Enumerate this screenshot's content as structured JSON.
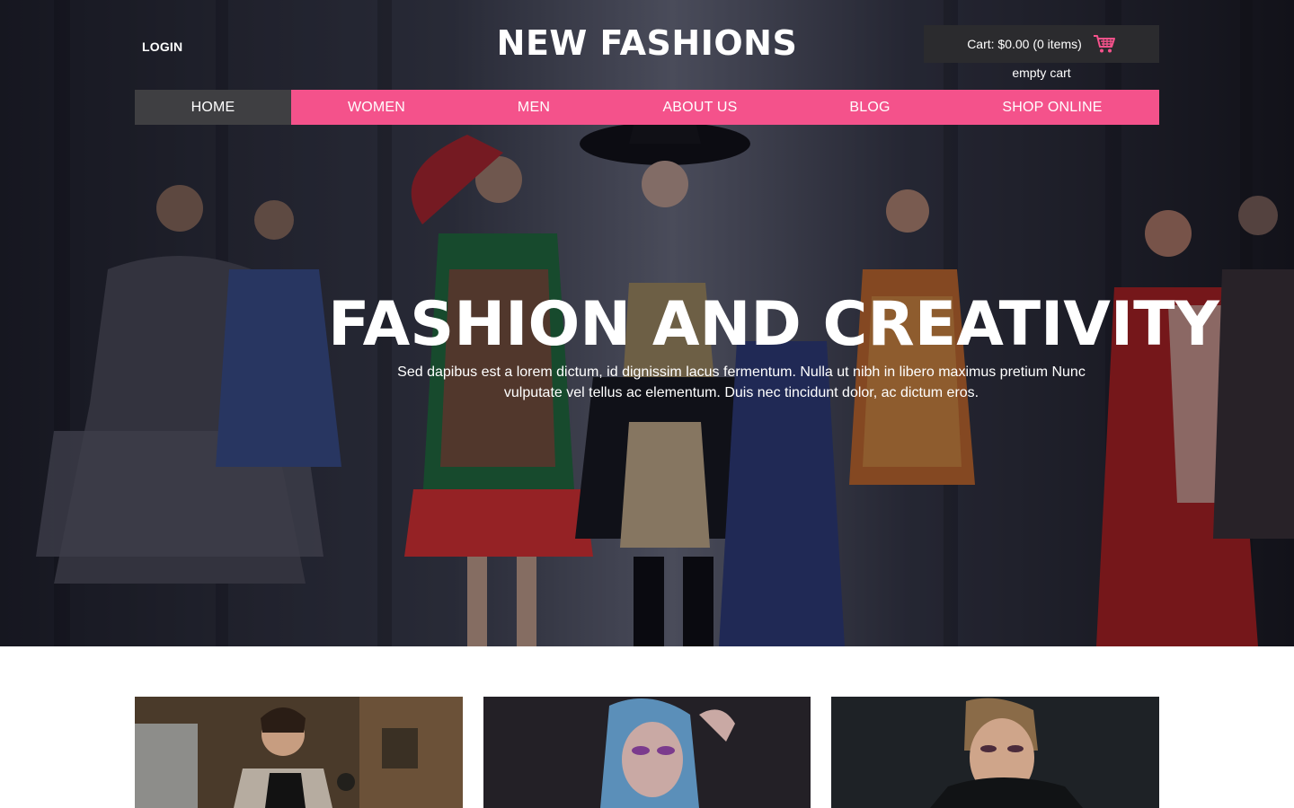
{
  "header": {
    "login_label": "LOGIN",
    "brand": "NEW FASHIONS",
    "cart_label": "Cart: $0.00 (0 items)",
    "cart_status": "empty cart"
  },
  "nav": {
    "items": [
      "HOME",
      "WOMEN",
      "MEN",
      "ABOUT US",
      "BLOG",
      "SHOP ONLINE"
    ],
    "active": "HOME"
  },
  "hero": {
    "title": "FASHION AND CREATIVITY",
    "subtitle": "Sed dapibus est a lorem dictum, id dignissim lacus fermentum. Nulla ut nibh in libero maximus pretium Nunc vulputate vel tellus ac elementum. Duis nec tincidunt dolor, ac dictum eros."
  },
  "colors": {
    "accent": "#f4528b",
    "nav_active": "#3f3f42",
    "cart_bg": "#2b2b2e"
  },
  "icons": {
    "cart": "shopping-cart-icon"
  }
}
